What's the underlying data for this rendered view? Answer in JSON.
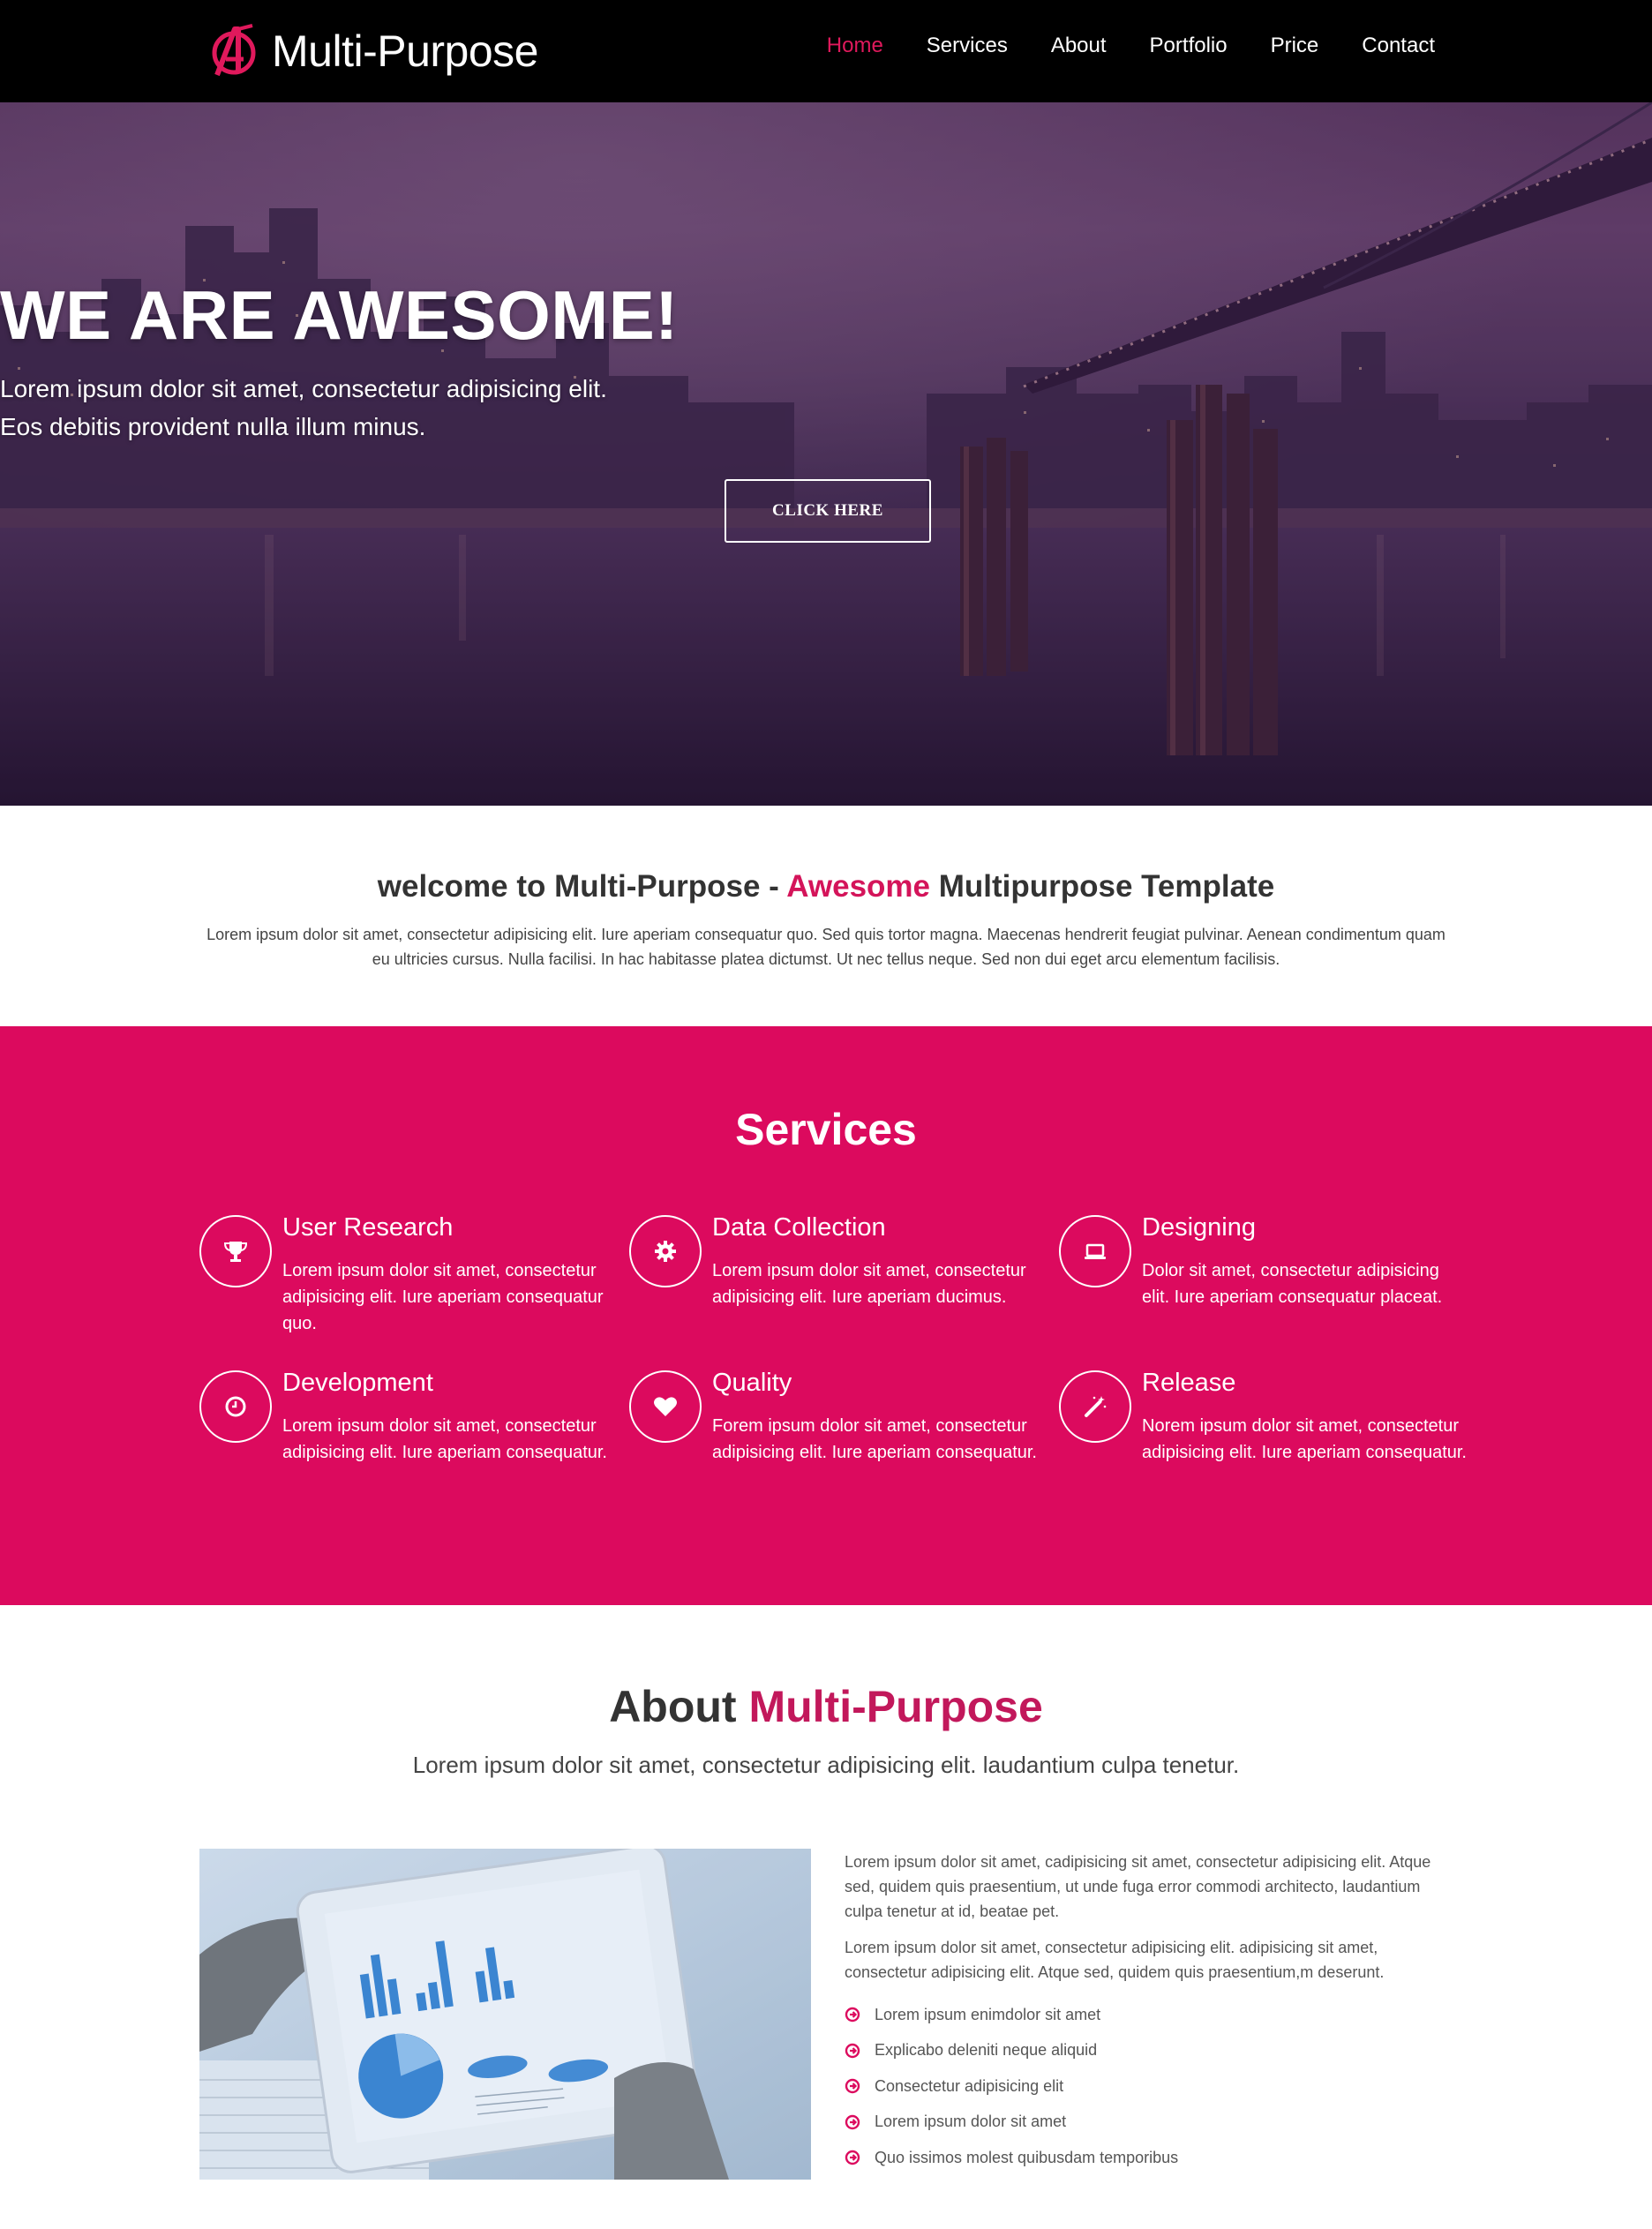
{
  "nav": {
    "brand": "Multi-Purpose",
    "items": [
      {
        "label": "Home",
        "active": true
      },
      {
        "label": "Services",
        "active": false
      },
      {
        "label": "About",
        "active": false
      },
      {
        "label": "Portfolio",
        "active": false
      },
      {
        "label": "Price",
        "active": false
      },
      {
        "label": "Contact",
        "active": false
      }
    ]
  },
  "hero": {
    "title": "WE ARE AWESOME!",
    "line1": "Lorem ipsum dolor sit amet, consectetur adipisicing elit.",
    "line2": "Eos debitis provident nulla illum minus.",
    "button": "CLICK HERE"
  },
  "welcome": {
    "prefix": "welcome to ",
    "brand": "Multi-Purpose",
    "dash": " - ",
    "accent": "Awesome",
    "suffix": " Multipurpose Template",
    "text": "Lorem ipsum dolor sit amet, consectetur adipisicing elit. Iure aperiam consequatur quo. Sed quis tortor magna. Maecenas hendrerit feugiat pulvinar. Aenean condimentum quam eu ultricies cursus. Nulla facilisi. In hac habitasse platea dictumst. Ut nec tellus neque. Sed non dui eget arcu elementum facilisis."
  },
  "services": {
    "title": "Services",
    "items": [
      {
        "title": "User Research",
        "text": "Lorem ipsum dolor sit amet, consectetur adipisicing elit. Iure aperiam consequatur quo.",
        "icon": "trophy-icon"
      },
      {
        "title": "Data Collection",
        "text": "Lorem ipsum dolor sit amet, consectetur adipisicing elit. Iure aperiam ducimus.",
        "icon": "gear-icon"
      },
      {
        "title": "Designing",
        "text": "Dolor sit amet, consectetur adipisicing elit. Iure aperiam consequatur placeat.",
        "icon": "laptop-icon"
      },
      {
        "title": "Development",
        "text": "Lorem ipsum dolor sit amet, consectetur adipisicing elit. Iure aperiam consequatur.",
        "icon": "clock-icon"
      },
      {
        "title": "Quality",
        "text": "Forem ipsum dolor sit amet, consectetur adipisicing elit. Iure aperiam consequatur.",
        "icon": "heart-icon"
      },
      {
        "title": "Release",
        "text": "Norem ipsum dolor sit amet, consectetur adipisicing elit. Iure aperiam consequatur.",
        "icon": "magic-wand-icon"
      }
    ]
  },
  "about": {
    "title_prefix": "About ",
    "title_accent": "Multi-Purpose",
    "subtitle": "Lorem ipsum dolor sit amet, consectetur adipisicing elit. laudantium culpa tenetur.",
    "p1": "Lorem ipsum dolor sit amet, cadipisicing sit amet, consectetur adipisicing elit. Atque sed, quidem quis praesentium, ut unde fuga error commodi architecto, laudantium culpa tenetur at id, beatae pet.",
    "p2": "Lorem ipsum dolor sit amet, consectetur adipisicing elit. adipisicing sit amet, consectetur adipisicing elit. Atque sed, quidem quis praesentium,m deserunt.",
    "list": [
      "Lorem ipsum enimdolor sit amet",
      "Explicabo deleniti neque aliquid",
      "Consectetur adipisicing elit",
      "Lorem ipsum dolor sit amet",
      "Quo issimos molest quibusdam temporibus"
    ]
  },
  "colors": {
    "accent": "#dc0a5e",
    "nav_active": "#e0195c",
    "navbar_bg": "#000000"
  }
}
